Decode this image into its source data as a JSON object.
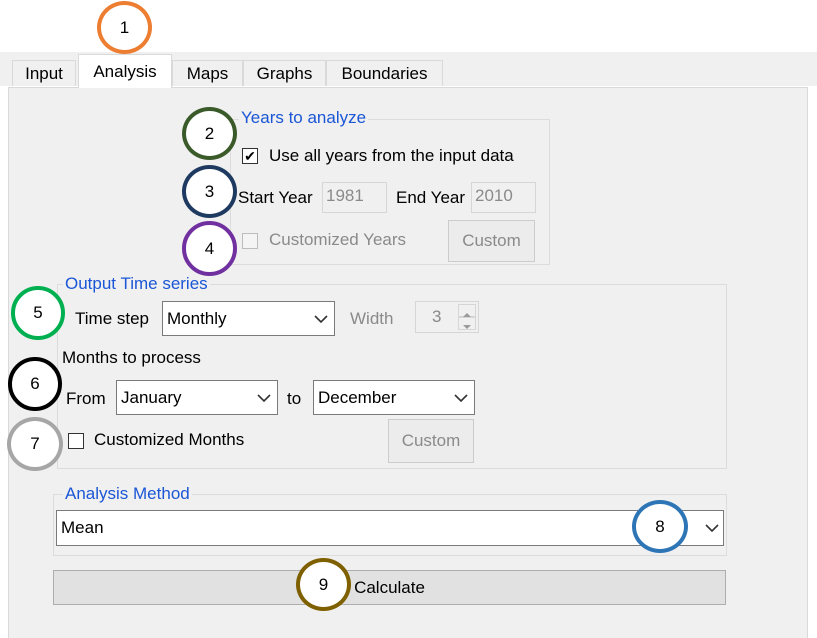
{
  "tabs": [
    "Input",
    "Analysis",
    "Maps",
    "Graphs",
    "Boundaries"
  ],
  "active_tab": "Analysis",
  "years_group": {
    "title": "Years to analyze",
    "use_all_label": "Use all years from the input data",
    "use_all_checked": true,
    "start_year_label": "Start Year",
    "start_year_value": "1981",
    "end_year_label": "End Year",
    "end_year_value": "2010",
    "customized_years_label": "Customized Years",
    "custom_button": "Custom"
  },
  "output_group": {
    "title": "Output Time series",
    "time_step_label": "Time step",
    "time_step_value": "Monthly",
    "width_label": "Width",
    "width_value": "3",
    "months_label": "Months to process",
    "from_label": "From",
    "from_value": "January",
    "to_label": "to",
    "to_value": "December",
    "customized_months_label": "Customized Months",
    "custom_button": "Custom"
  },
  "method_group": {
    "title": "Analysis Method",
    "value": "Mean"
  },
  "calculate_button": "Calculate",
  "markers": [
    {
      "label": "1",
      "color": "#ed7d31"
    },
    {
      "label": "2",
      "color": "#3a5a2a"
    },
    {
      "label": "3",
      "color": "#1f3a60"
    },
    {
      "label": "4",
      "color": "#7030a0"
    },
    {
      "label": "5",
      "color": "#00b050"
    },
    {
      "label": "6",
      "color": "#000000"
    },
    {
      "label": "7",
      "color": "#a6a6a6"
    },
    {
      "label": "8",
      "color": "#2e75b6"
    },
    {
      "label": "9",
      "color": "#7f6000"
    }
  ]
}
